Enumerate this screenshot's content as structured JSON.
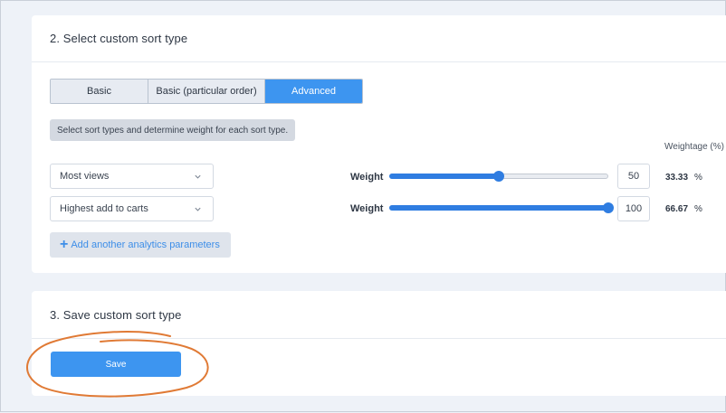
{
  "section2": {
    "title": "2. Select custom sort type",
    "tabs": [
      {
        "label": "Basic",
        "active": false
      },
      {
        "label": "Basic (particular order)",
        "active": false
      },
      {
        "label": "Advanced",
        "active": true
      }
    ],
    "hint": "Select sort types and determine weight for each sort type.",
    "weightage_header": "Weightage (%)",
    "rows": [
      {
        "param": "Most views",
        "weight_label": "Weight",
        "weight": 50,
        "slider_fraction": 0.5,
        "percent": "33.33",
        "percent_symbol": "%"
      },
      {
        "param": "Highest add to carts",
        "weight_label": "Weight",
        "weight": 100,
        "slider_fraction": 1.0,
        "percent": "66.67",
        "percent_symbol": "%"
      }
    ],
    "add_button_label": "Add another analytics parameters"
  },
  "section3": {
    "title": "3. Save custom sort type",
    "save_label": "Save"
  },
  "colors": {
    "accent": "#3d95f0",
    "slider": "#2f7de1",
    "highlight_circle": "#e07a35"
  },
  "icons": {
    "dropdown": "chevron-down-icon",
    "add": "plus-icon"
  }
}
